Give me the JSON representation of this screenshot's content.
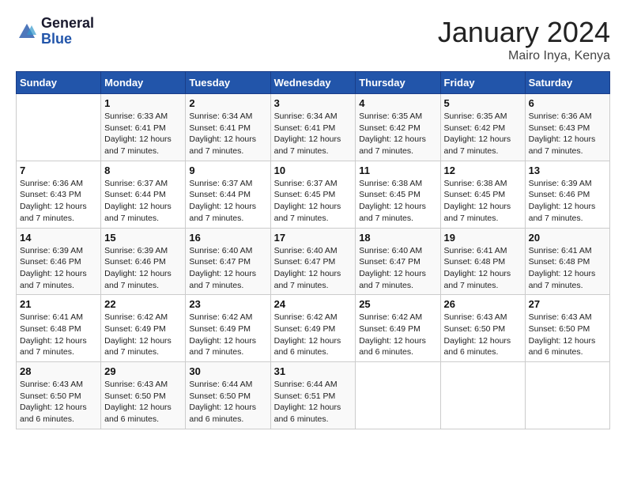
{
  "header": {
    "logo_line1": "General",
    "logo_line2": "Blue",
    "month": "January 2024",
    "location": "Mairo Inya, Kenya"
  },
  "days_of_week": [
    "Sunday",
    "Monday",
    "Tuesday",
    "Wednesday",
    "Thursday",
    "Friday",
    "Saturday"
  ],
  "weeks": [
    [
      {
        "day": "",
        "sunrise": "",
        "sunset": "",
        "daylight": ""
      },
      {
        "day": "1",
        "sunrise": "Sunrise: 6:33 AM",
        "sunset": "Sunset: 6:41 PM",
        "daylight": "Daylight: 12 hours and 7 minutes."
      },
      {
        "day": "2",
        "sunrise": "Sunrise: 6:34 AM",
        "sunset": "Sunset: 6:41 PM",
        "daylight": "Daylight: 12 hours and 7 minutes."
      },
      {
        "day": "3",
        "sunrise": "Sunrise: 6:34 AM",
        "sunset": "Sunset: 6:41 PM",
        "daylight": "Daylight: 12 hours and 7 minutes."
      },
      {
        "day": "4",
        "sunrise": "Sunrise: 6:35 AM",
        "sunset": "Sunset: 6:42 PM",
        "daylight": "Daylight: 12 hours and 7 minutes."
      },
      {
        "day": "5",
        "sunrise": "Sunrise: 6:35 AM",
        "sunset": "Sunset: 6:42 PM",
        "daylight": "Daylight: 12 hours and 7 minutes."
      },
      {
        "day": "6",
        "sunrise": "Sunrise: 6:36 AM",
        "sunset": "Sunset: 6:43 PM",
        "daylight": "Daylight: 12 hours and 7 minutes."
      }
    ],
    [
      {
        "day": "7",
        "sunrise": "Sunrise: 6:36 AM",
        "sunset": "Sunset: 6:43 PM",
        "daylight": "Daylight: 12 hours and 7 minutes."
      },
      {
        "day": "8",
        "sunrise": "Sunrise: 6:37 AM",
        "sunset": "Sunset: 6:44 PM",
        "daylight": "Daylight: 12 hours and 7 minutes."
      },
      {
        "day": "9",
        "sunrise": "Sunrise: 6:37 AM",
        "sunset": "Sunset: 6:44 PM",
        "daylight": "Daylight: 12 hours and 7 minutes."
      },
      {
        "day": "10",
        "sunrise": "Sunrise: 6:37 AM",
        "sunset": "Sunset: 6:45 PM",
        "daylight": "Daylight: 12 hours and 7 minutes."
      },
      {
        "day": "11",
        "sunrise": "Sunrise: 6:38 AM",
        "sunset": "Sunset: 6:45 PM",
        "daylight": "Daylight: 12 hours and 7 minutes."
      },
      {
        "day": "12",
        "sunrise": "Sunrise: 6:38 AM",
        "sunset": "Sunset: 6:45 PM",
        "daylight": "Daylight: 12 hours and 7 minutes."
      },
      {
        "day": "13",
        "sunrise": "Sunrise: 6:39 AM",
        "sunset": "Sunset: 6:46 PM",
        "daylight": "Daylight: 12 hours and 7 minutes."
      }
    ],
    [
      {
        "day": "14",
        "sunrise": "Sunrise: 6:39 AM",
        "sunset": "Sunset: 6:46 PM",
        "daylight": "Daylight: 12 hours and 7 minutes."
      },
      {
        "day": "15",
        "sunrise": "Sunrise: 6:39 AM",
        "sunset": "Sunset: 6:46 PM",
        "daylight": "Daylight: 12 hours and 7 minutes."
      },
      {
        "day": "16",
        "sunrise": "Sunrise: 6:40 AM",
        "sunset": "Sunset: 6:47 PM",
        "daylight": "Daylight: 12 hours and 7 minutes."
      },
      {
        "day": "17",
        "sunrise": "Sunrise: 6:40 AM",
        "sunset": "Sunset: 6:47 PM",
        "daylight": "Daylight: 12 hours and 7 minutes."
      },
      {
        "day": "18",
        "sunrise": "Sunrise: 6:40 AM",
        "sunset": "Sunset: 6:47 PM",
        "daylight": "Daylight: 12 hours and 7 minutes."
      },
      {
        "day": "19",
        "sunrise": "Sunrise: 6:41 AM",
        "sunset": "Sunset: 6:48 PM",
        "daylight": "Daylight: 12 hours and 7 minutes."
      },
      {
        "day": "20",
        "sunrise": "Sunrise: 6:41 AM",
        "sunset": "Sunset: 6:48 PM",
        "daylight": "Daylight: 12 hours and 7 minutes."
      }
    ],
    [
      {
        "day": "21",
        "sunrise": "Sunrise: 6:41 AM",
        "sunset": "Sunset: 6:48 PM",
        "daylight": "Daylight: 12 hours and 7 minutes."
      },
      {
        "day": "22",
        "sunrise": "Sunrise: 6:42 AM",
        "sunset": "Sunset: 6:49 PM",
        "daylight": "Daylight: 12 hours and 7 minutes."
      },
      {
        "day": "23",
        "sunrise": "Sunrise: 6:42 AM",
        "sunset": "Sunset: 6:49 PM",
        "daylight": "Daylight: 12 hours and 7 minutes."
      },
      {
        "day": "24",
        "sunrise": "Sunrise: 6:42 AM",
        "sunset": "Sunset: 6:49 PM",
        "daylight": "Daylight: 12 hours and 6 minutes."
      },
      {
        "day": "25",
        "sunrise": "Sunrise: 6:42 AM",
        "sunset": "Sunset: 6:49 PM",
        "daylight": "Daylight: 12 hours and 6 minutes."
      },
      {
        "day": "26",
        "sunrise": "Sunrise: 6:43 AM",
        "sunset": "Sunset: 6:50 PM",
        "daylight": "Daylight: 12 hours and 6 minutes."
      },
      {
        "day": "27",
        "sunrise": "Sunrise: 6:43 AM",
        "sunset": "Sunset: 6:50 PM",
        "daylight": "Daylight: 12 hours and 6 minutes."
      }
    ],
    [
      {
        "day": "28",
        "sunrise": "Sunrise: 6:43 AM",
        "sunset": "Sunset: 6:50 PM",
        "daylight": "Daylight: 12 hours and 6 minutes."
      },
      {
        "day": "29",
        "sunrise": "Sunrise: 6:43 AM",
        "sunset": "Sunset: 6:50 PM",
        "daylight": "Daylight: 12 hours and 6 minutes."
      },
      {
        "day": "30",
        "sunrise": "Sunrise: 6:44 AM",
        "sunset": "Sunset: 6:50 PM",
        "daylight": "Daylight: 12 hours and 6 minutes."
      },
      {
        "day": "31",
        "sunrise": "Sunrise: 6:44 AM",
        "sunset": "Sunset: 6:51 PM",
        "daylight": "Daylight: 12 hours and 6 minutes."
      },
      {
        "day": "",
        "sunrise": "",
        "sunset": "",
        "daylight": ""
      },
      {
        "day": "",
        "sunrise": "",
        "sunset": "",
        "daylight": ""
      },
      {
        "day": "",
        "sunrise": "",
        "sunset": "",
        "daylight": ""
      }
    ]
  ]
}
